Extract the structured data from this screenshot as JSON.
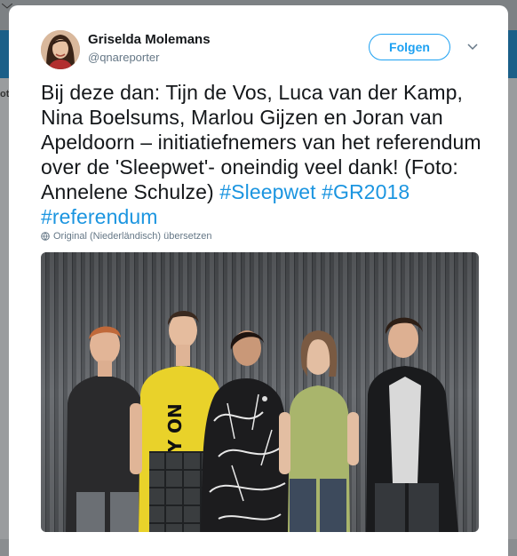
{
  "tweet": {
    "author_name": "Griselda Molemans",
    "author_handle": "@qnareporter",
    "follow_label": "Folgen",
    "text_plain": "Bij deze dan: Tijn de Vos, Luca van der Kamp, Nina Boelsums, Marlou Gijzen en Joran van Apeldoorn – initiatiefnemers van het referendum over de 'Sleepwet'- oneindig veel dank! (Foto: Annelene Schulze)",
    "hashtags": [
      "#Sleepwet",
      "#GR2018",
      "#referendum"
    ],
    "translate_label": "Original (Niederländisch) übersetzen"
  },
  "background": {
    "left_edge_text": "ot"
  },
  "icons": {
    "caret": "chevron-down-icon",
    "globe": "globe-icon"
  },
  "colors": {
    "accent": "#1da1f2",
    "hashtag": "#1b95e0",
    "secondary_text": "#657786",
    "header_bar": "#1b5f88"
  }
}
